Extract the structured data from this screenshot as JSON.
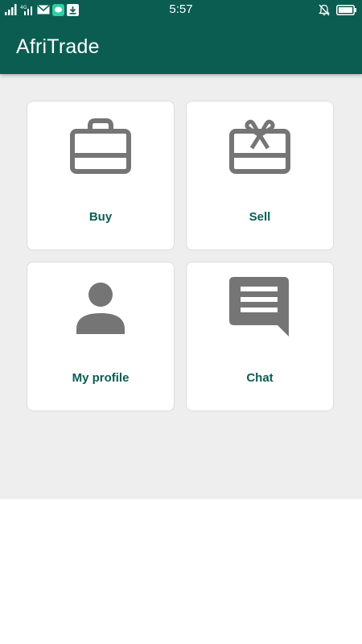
{
  "status_bar": {
    "time": "5:57",
    "network_label": "4G"
  },
  "app_bar": {
    "title": "AfriTrade"
  },
  "menu": {
    "buy_label": "Buy",
    "sell_label": "Sell",
    "profile_label": "My profile",
    "chat_label": "Chat"
  },
  "colors": {
    "primary": "#0b5d52",
    "content_background": "#eeeeee",
    "icon_gray": "#757575"
  }
}
